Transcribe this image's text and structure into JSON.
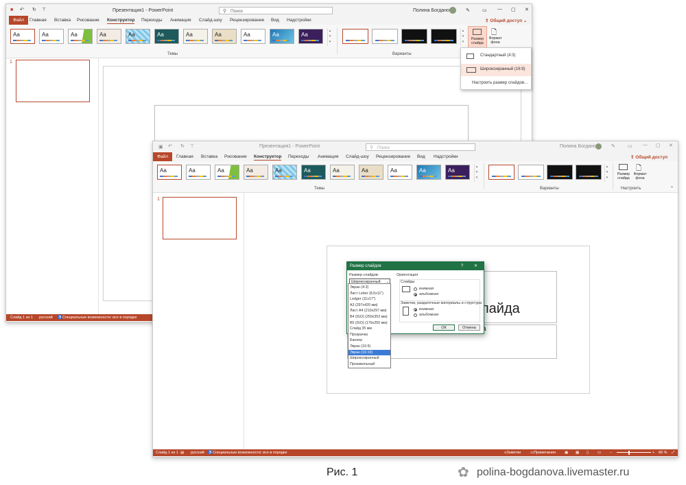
{
  "back_window": {
    "app_title": "Презентация1 - PowerPoint",
    "search_placeholder": "Поиск",
    "user": "Полина Богданова",
    "share": "Общий доступ",
    "tabs": [
      "Файл",
      "Главная",
      "Вставка",
      "Рисование",
      "Конструктор",
      "Переходы",
      "Анимация",
      "Слайд-шоу",
      "Рецензирование",
      "Вид",
      "Надстройки"
    ],
    "group_themes": "Темы",
    "group_variants": "Варианты",
    "slide_size_button": "Размер слайда",
    "format_bg_button": "Формат фона",
    "dropdown": {
      "standard": "Стандартный (4:3)",
      "widescreen": "Широкоэкранный (16:9)",
      "custom": "Настроить размер слайдов..."
    },
    "slide_number": "1",
    "status": {
      "slide": "Слайд 1 из 1",
      "lang": "русский",
      "accessibility": "Специальные возможности: все в порядке"
    }
  },
  "front_window": {
    "app_title": "Презентация1 - PowerPoint",
    "search_placeholder": "Поиск",
    "user": "Полина Богданова",
    "share": "Общий доступ",
    "tabs": [
      "Файл",
      "Главная",
      "Вставка",
      "Рисование",
      "Конструктор",
      "Переходы",
      "Анимация",
      "Слайд-шоу",
      "Рецензирование",
      "Вид",
      "Надстройки"
    ],
    "group_themes": "Темы",
    "group_variants": "Варианты",
    "group_customize": "Настроить",
    "slide_size_button": "Размер слайда",
    "format_bg_button": "Формат фона",
    "slide_number": "1",
    "slide_title_fragment": "лайда",
    "slide_subtitle_fragment": "а",
    "status": {
      "slide": "Слайд 1 из 1",
      "lang": "русский",
      "accessibility": "Специальные возможности: все в порядке",
      "notes": "Заметки",
      "comments": "Примечания",
      "zoom": "66 %"
    }
  },
  "dialog": {
    "title": "Размер слайдов",
    "help": "?",
    "close": "✕",
    "size_label": "Размер слайдов:",
    "selected_size": "Широкоэкранный",
    "options": [
      "Экран (4:3)",
      "Лист Letter (8,5x11\")",
      "Ledger (11x17\")",
      "A3 (297x420 мм)",
      "Лист A4 (210x297 мм)",
      "B4 (ISO) (250x353 мм)",
      "B5 (ISO) (176x250 мм)",
      "Слайд 35 мм",
      "Прозрачка",
      "Баннер",
      "Экран (16:9)",
      "Экран (16:10)",
      "Широкоэкранный",
      "Произвольный"
    ],
    "highlighted_index": 11,
    "orientation_label": "Ориентация",
    "slides_label": "Слайды",
    "portrait": "книжная",
    "landscape": "альбомная",
    "notes_label": "Заметки, раздаточные материалы и структура",
    "ok": "ОК",
    "cancel": "Отмена"
  },
  "caption": "Рис. 1",
  "watermark": "polina-bogdanova.livemaster.ru",
  "colors": {
    "accent": "#b7472a",
    "dialog_green": "#217346",
    "selection_blue": "#3a7bd5"
  }
}
